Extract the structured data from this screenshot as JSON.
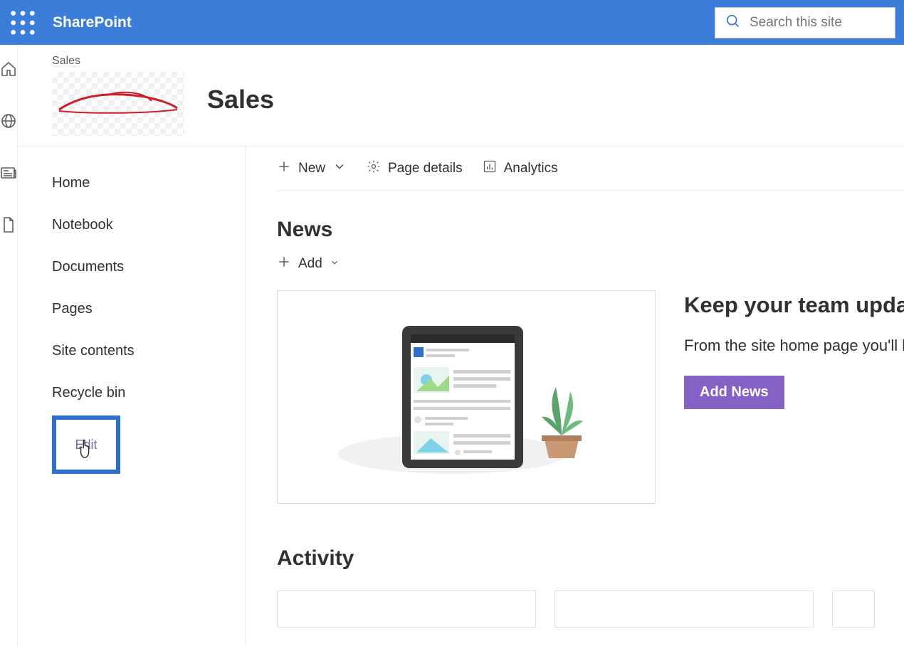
{
  "header": {
    "app_name": "SharePoint",
    "search_placeholder": "Search this site"
  },
  "site": {
    "breadcrumb": "Sales",
    "title": "Sales"
  },
  "sidebar": {
    "items": [
      {
        "label": "Home"
      },
      {
        "label": "Notebook"
      },
      {
        "label": "Documents"
      },
      {
        "label": "Pages"
      },
      {
        "label": "Site contents"
      },
      {
        "label": "Recycle bin"
      }
    ],
    "edit_label": "Edit"
  },
  "toolbar": {
    "new_label": "New",
    "page_details_label": "Page details",
    "analytics_label": "Analytics"
  },
  "news": {
    "section_title": "News",
    "add_label": "Add",
    "heading": "Keep your team updated with news on your team site",
    "desc": "From the site home page you'll be able to quickly author a news post – a status update",
    "button_label": "Add News"
  },
  "activity": {
    "section_title": "Activity"
  },
  "colors": {
    "brand": "#3b7dd8",
    "accent": "#8661c5"
  }
}
